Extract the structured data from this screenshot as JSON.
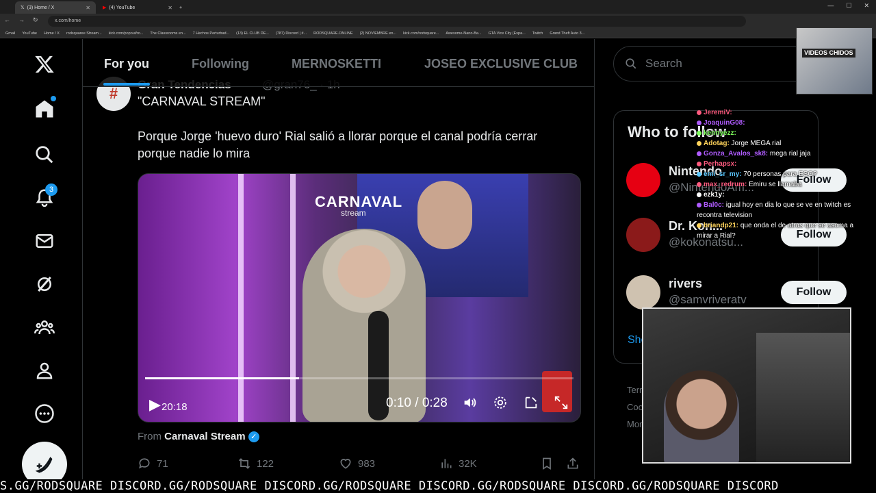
{
  "browser": {
    "tabs": [
      {
        "label": "(3) Home / X",
        "active": true
      },
      {
        "label": "(4) YouTube",
        "active": false
      }
    ],
    "url": "x.com/home",
    "bookmarks": [
      "Gmail",
      "YouTube",
      "Home / X",
      "rodsquaree Stream...",
      "kick.com/popout/ro...",
      "The Classrooms en...",
      "7 Hechos Perturbad...",
      "(13) EL CLUB DE...",
      "(787) Discord | #...",
      "RODSQUARE.ONLINE",
      "(2) NOVIEMBRE en...",
      "kick.com/rodsquare...",
      "Awesome-Nano-Ba...",
      "GTA Vice City (Espa...",
      "Twitch",
      "Grand Theft Auto 3..."
    ]
  },
  "nav": {
    "notifications_badge": "3",
    "items": [
      "x-logo",
      "home",
      "explore",
      "notifications",
      "messages",
      "grok",
      "communities",
      "profile",
      "more",
      "post"
    ]
  },
  "timeline": {
    "tabs": [
      "For you",
      "Following",
      "MERNOSKETTI",
      "JOSEO EXCLUSIVE CLUB"
    ],
    "tweet": {
      "author": "Gran Tendencias",
      "handle": "@gran76_ · 1h",
      "title": "\"CARNAVAL STREAM\"",
      "body": "Porque Jorge 'huevo duro' Rial salió a llorar porque el canal podría cerrar porque nadie lo mira",
      "video": {
        "logo": "CARNAVAL",
        "logo_sub": "stream",
        "elapsed_label": "20:18",
        "time": "0:10 / 0:28",
        "progress": 0.36
      },
      "from_prefix": "From",
      "from_source": "Carnaval Stream",
      "stats": {
        "replies": "71",
        "reposts": "122",
        "likes": "983",
        "views": "32K"
      }
    }
  },
  "sidebar": {
    "search_placeholder": "Search",
    "who_to_follow": "Who to follow",
    "accounts": [
      {
        "name": "Nintendo",
        "handle": "@NintendoAm...",
        "button": "Follow",
        "color": "#e60012"
      },
      {
        "name": "Dr. Kon...",
        "handle": "@kokonatsu...",
        "button": "Follow",
        "color": "#8b1a1a"
      },
      {
        "name": "rivers",
        "handle": "@samvriveratv",
        "button": "Follow",
        "color": "#cfc2b0"
      }
    ],
    "show_more": "Show more",
    "footer": [
      "Terms of Service",
      "Cookie Policy",
      "More ..."
    ]
  },
  "stream_overlay": {
    "top_cam_label": "VIDEOS CHIDOS",
    "chat": [
      {
        "user": "JeremiV",
        "msg": "",
        "color": "#ff5b7f"
      },
      {
        "user": "JoaquinG08",
        "msg": "",
        "color": "#b05cff"
      },
      {
        "user": "kennyezz",
        "msg": "",
        "color": "#7cff5b"
      },
      {
        "user": "Adotag",
        "msg": "Jorge MEGA rial",
        "color": "#ffd45b"
      },
      {
        "user": "Gonza_Avalos_sk8",
        "msg": "mega rial jaja",
        "color": "#b05cff"
      },
      {
        "user": "Perhapsx",
        "msg": "",
        "color": "#ff5b7f"
      },
      {
        "user": "emi_sr_my",
        "msg": "70 personas para ESO?",
        "color": "#5bc8ff"
      },
      {
        "user": "max_redrum",
        "msg": "Emiru se llamaba",
        "color": "#ff5b7f"
      },
      {
        "user": "ezk1y",
        "msg": "",
        "color": "#ffffff"
      },
      {
        "user": "Bal0c",
        "msg": "igual hoy en dia lo que se ve en twitch es recontra television",
        "color": "#b05cff"
      },
      {
        "user": "briandp21",
        "msg": "que onda el de atras que se asoma a mirar a Rial?",
        "color": "#ffd45b"
      }
    ],
    "ticker": "S.GG/RODSQUARE DISCORD.GG/RODSQUARE DISCORD.GG/RODSQUARE DISCORD.GG/RODSQUARE DISCORD.GG/RODSQUARE DISCORD"
  }
}
